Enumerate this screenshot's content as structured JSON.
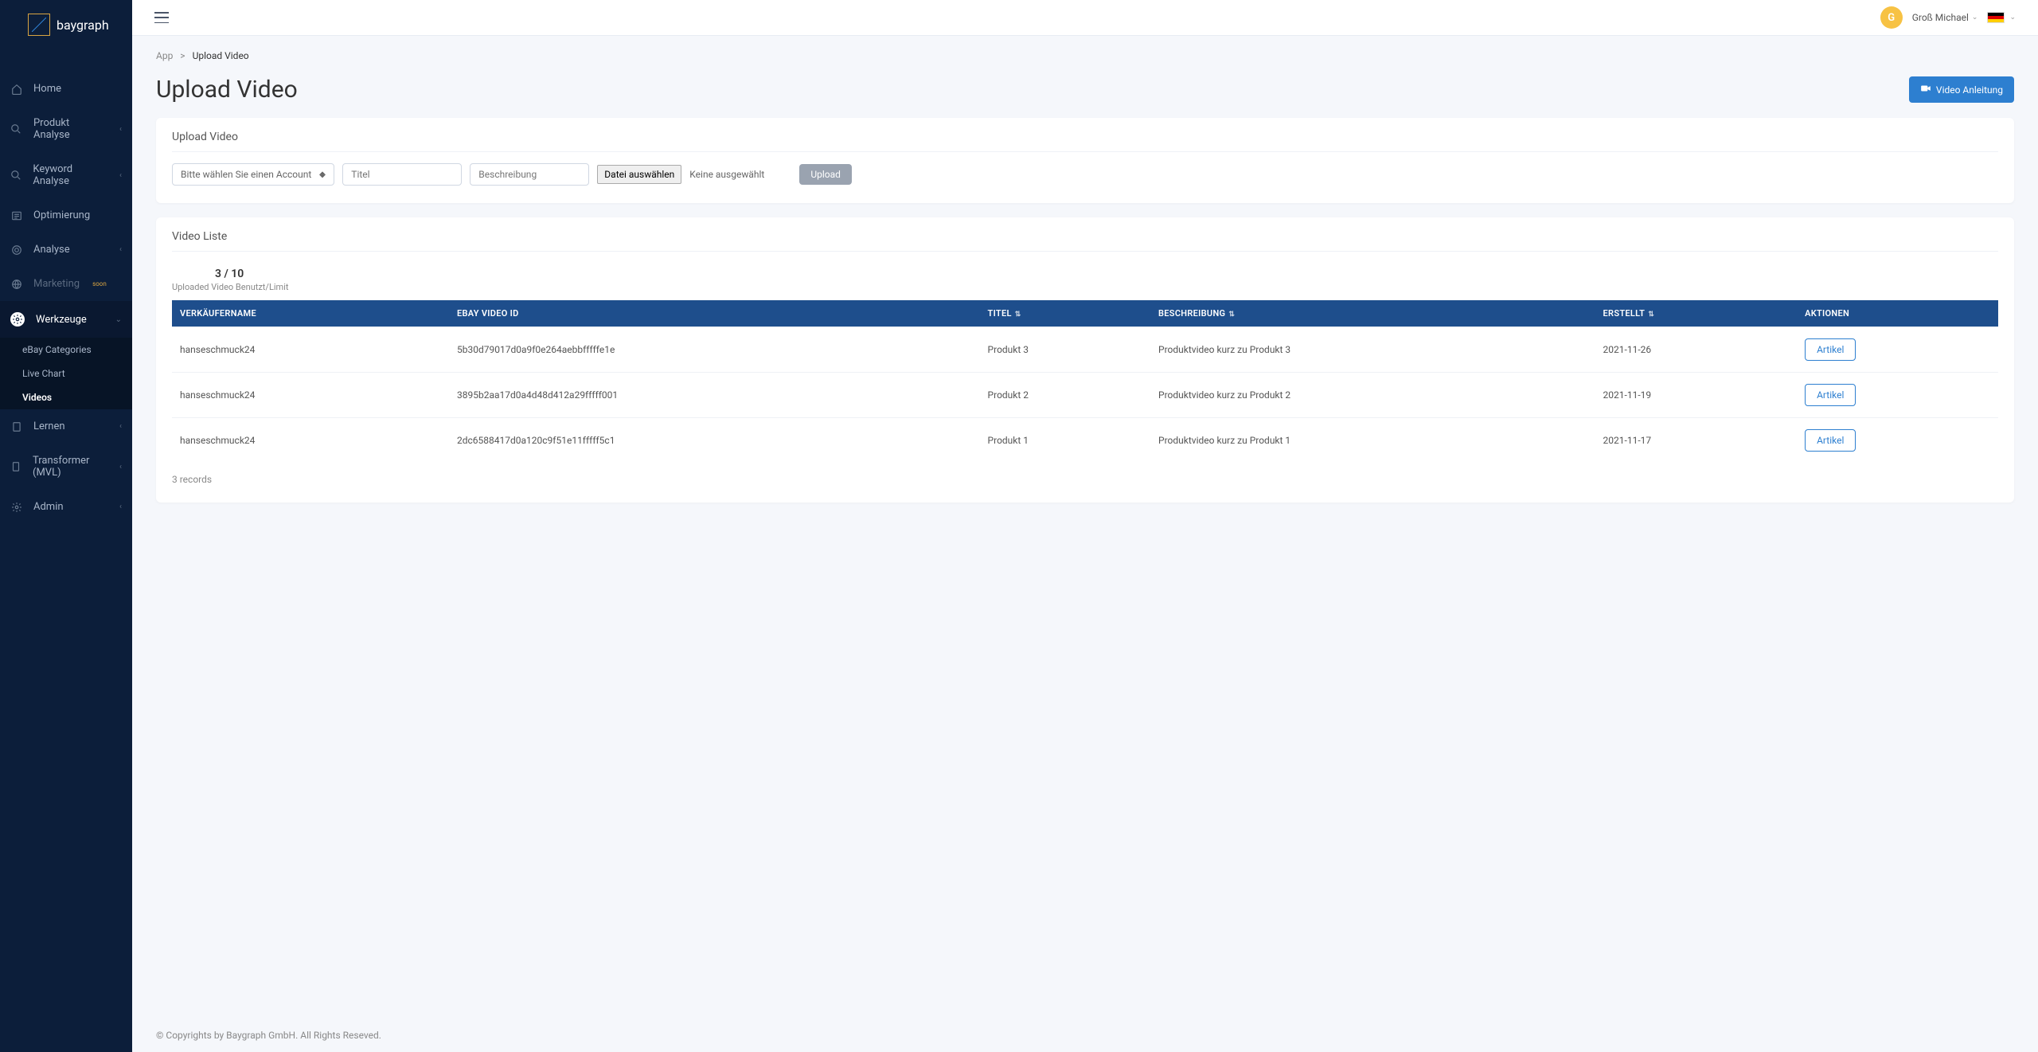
{
  "brand": "baygraph",
  "user": {
    "initial": "G",
    "name": "Groß Michael"
  },
  "sidebar": {
    "items": [
      {
        "label": "Home"
      },
      {
        "label": "Produkt Analyse",
        "chevron": true
      },
      {
        "label": "Keyword Analyse",
        "chevron": true
      },
      {
        "label": "Optimierung"
      },
      {
        "label": "Analyse",
        "chevron": true
      },
      {
        "label": "Marketing",
        "soon": "soon",
        "dim": true
      },
      {
        "label": "Werkzeuge",
        "chevron": true,
        "active": true
      },
      {
        "label": "Lernen",
        "chevron": true
      },
      {
        "label": "Transformer (MVL)",
        "chevron": true
      },
      {
        "label": "Admin",
        "chevron": true
      }
    ],
    "subitems": [
      {
        "label": "eBay Categories"
      },
      {
        "label": "Live Chart"
      },
      {
        "label": "Videos",
        "current": true
      }
    ]
  },
  "breadcrumb": {
    "root": "App",
    "current": "Upload Video"
  },
  "page_title": "Upload Video",
  "guide_button": "Video Anleitung",
  "upload_card": {
    "title": "Upload Video",
    "account_placeholder": "Bitte wählen Sie einen Account",
    "title_placeholder": "Titel",
    "desc_placeholder": "Beschreibung",
    "file_button": "Datei auswählen",
    "file_label": "Keine ausgewählt",
    "upload_button": "Upload"
  },
  "list_card": {
    "title": "Video Liste",
    "limit": "3 / 10",
    "limit_label": "Uploaded Video Benutzt/Limit",
    "columns": {
      "seller": "VERKÄUFERNAME",
      "video_id": "EBAY VIDEO ID",
      "title": "TITEL",
      "desc": "BESCHREIBUNG",
      "created": "ERSTELLT",
      "actions": "AKTIONEN"
    },
    "action_label": "Artikel",
    "rows": [
      {
        "seller": "hanseschmuck24",
        "video_id": "5b30d79017d0a9f0e264aebbfffffe1e",
        "title": "Produkt 3",
        "desc": "Produktvideo kurz zu Produkt 3",
        "created": "2021-11-26"
      },
      {
        "seller": "hanseschmuck24",
        "video_id": "3895b2aa17d0a4d48d412a29fffff001",
        "title": "Produkt 2",
        "desc": "Produktvideo kurz zu Produkt 2",
        "created": "2021-11-19"
      },
      {
        "seller": "hanseschmuck24",
        "video_id": "2dc6588417d0a120c9f51e11fffff5c1",
        "title": "Produkt 1",
        "desc": "Produktvideo kurz zu Produkt 1",
        "created": "2021-11-17"
      }
    ],
    "records": "3 records"
  },
  "footer": "© Copyrights by Baygraph GmbH. All Rights Reseved."
}
